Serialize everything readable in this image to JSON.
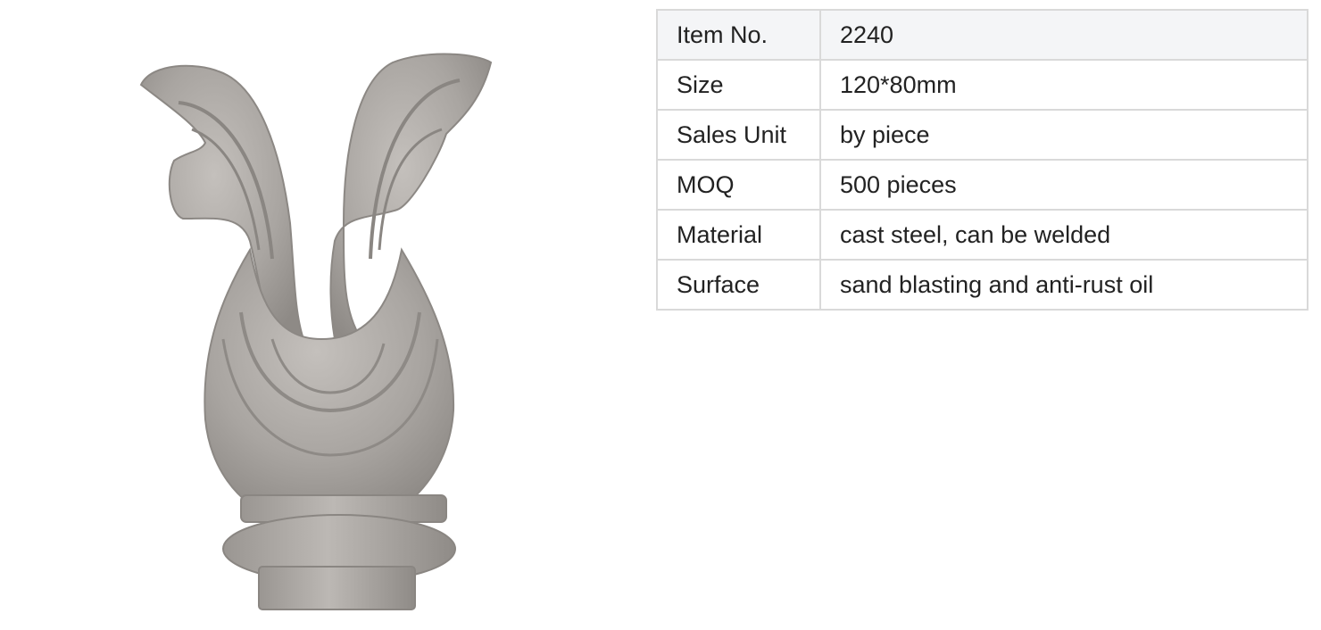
{
  "product": {
    "image_description_icon": "cast-steel-leaf-finial-image"
  },
  "specs": {
    "rows": [
      {
        "label": "Item No.",
        "value": "2240"
      },
      {
        "label": "Size",
        "value": "120*80mm"
      },
      {
        "label": "Sales Unit",
        "value": "by piece"
      },
      {
        "label": "MOQ",
        "value": "500 pieces"
      },
      {
        "label": "Material",
        "value": "cast steel, can be welded"
      },
      {
        "label": "Surface",
        "value": "sand blasting and anti-rust oil"
      }
    ]
  },
  "colors": {
    "border": "#d9d9d9",
    "header_row_bg": "#f4f5f7",
    "text": "#222222",
    "metal": "#a8a4a0"
  }
}
